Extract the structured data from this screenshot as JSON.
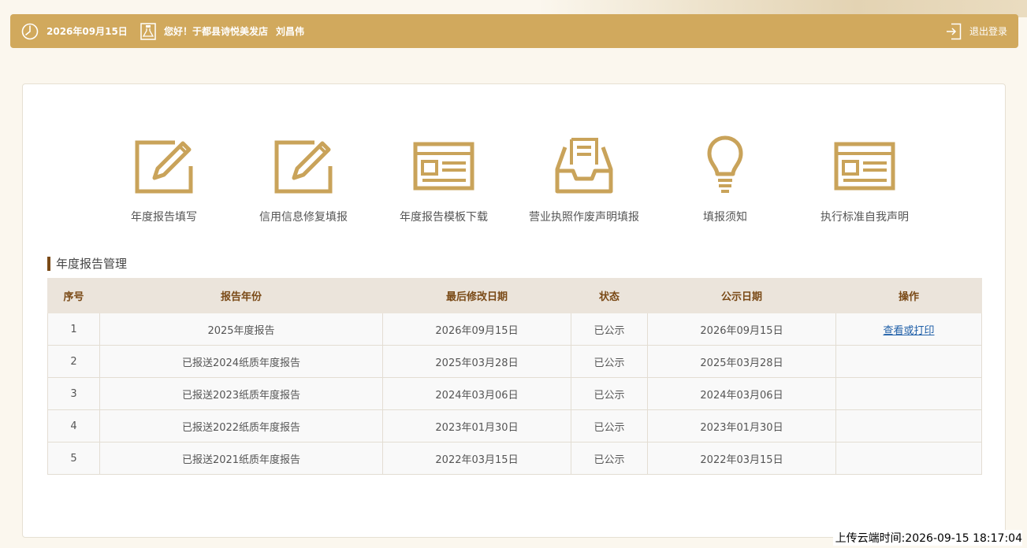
{
  "header": {
    "date": "2026年09月15日",
    "greeting": "您好！于都县诗悦美发店",
    "user_name": "刘昌伟",
    "logout_label": "退出登录"
  },
  "tiles": [
    {
      "label": "年度报告填写",
      "icon": "edit-icon"
    },
    {
      "label": "信用信息修复填报",
      "icon": "edit-icon"
    },
    {
      "label": "年度报告模板下载",
      "icon": "template-icon"
    },
    {
      "label": "营业执照作废声明填报",
      "icon": "inbox-icon"
    },
    {
      "label": "填报须知",
      "icon": "lightbulb-icon"
    },
    {
      "label": "执行标准自我声明",
      "icon": "template-icon"
    }
  ],
  "section": {
    "title": "年度报告管理"
  },
  "table": {
    "columns": [
      "序号",
      "报告年份",
      "最后修改日期",
      "状态",
      "公示日期",
      "操作"
    ],
    "rows": [
      {
        "no": "1",
        "year": "2025年度报告",
        "modified": "2026年09月15日",
        "status": "已公示",
        "published": "2026年09月15日",
        "action": "查看或打印"
      },
      {
        "no": "2",
        "year": "已报送2024纸质年度报告",
        "modified": "2025年03月28日",
        "status": "已公示",
        "published": "2025年03月28日",
        "action": ""
      },
      {
        "no": "3",
        "year": "已报送2023纸质年度报告",
        "modified": "2024年03月06日",
        "status": "已公示",
        "published": "2024年03月06日",
        "action": ""
      },
      {
        "no": "4",
        "year": "已报送2022纸质年度报告",
        "modified": "2023年01月30日",
        "status": "已公示",
        "published": "2023年01月30日",
        "action": ""
      },
      {
        "no": "5",
        "year": "已报送2021纸质年度报告",
        "modified": "2022年03月15日",
        "status": "已公示",
        "published": "2022年03月15日",
        "action": ""
      }
    ]
  },
  "footer": {
    "upload_time": "上传云端时间:2026-09-15 18:17:04"
  },
  "colors": {
    "accent": "#d1a95d",
    "icon": "#c9a35a",
    "header_text": "#7a4a17",
    "link": "#1f5fa8"
  }
}
